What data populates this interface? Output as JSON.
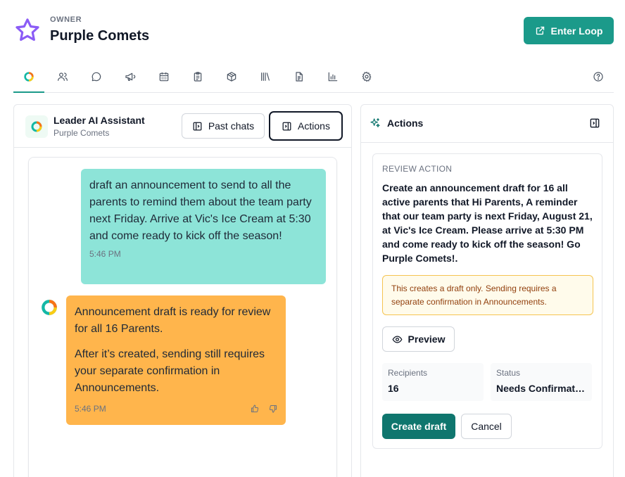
{
  "header": {
    "owner_label": "OWNER",
    "team_name": "Purple Comets",
    "enter_loop_label": "Enter Loop",
    "star_icon": "star-icon",
    "colors": {
      "accent": "#1b9a8a",
      "star": "#8b5cf6"
    }
  },
  "tabs": {
    "icons": [
      "loop-icon",
      "people-icon",
      "chat-icon",
      "megaphone-icon",
      "calendar-icon",
      "clipboard-icon",
      "box-icon",
      "library-icon",
      "document-icon",
      "chart-icon",
      "gear-icon",
      "help-icon"
    ],
    "active": "loop-icon"
  },
  "chat_panel": {
    "assistant_title": "Leader AI Assistant",
    "assistant_subtitle": "Purple Comets",
    "past_chats_label": "Past chats",
    "actions_label": "Actions",
    "messages": [
      {
        "role": "user",
        "text": "draft an announcement to send to all the parents to remind them about the team party next Friday. Arrive at Vic's Ice Cream at 5:30 and come ready to kick off the season!",
        "time": "5:46 PM",
        "color": "#8de4d8"
      },
      {
        "role": "assistant",
        "paragraphs": [
          "Announcement draft is ready for review for all 16 Parents.",
          "After it’s created, sending still requires your separate confirmation in Announcements."
        ],
        "time": "5:46 PM",
        "color": "#ffb54c"
      }
    ]
  },
  "actions_panel": {
    "title": "Actions",
    "review_label": "REVIEW ACTION",
    "description": "Create an announcement draft for 16 all active parents that Hi Parents, A reminder that our team party is next Friday, August 21, at Vic's Ice Cream. Please arrive at 5:30 PM and come ready to kick off the season! Go Purple Comets!.",
    "warning": "This creates a draft only. Sending requires a separate confirmation in Announcements.",
    "preview_label": "Preview",
    "recipients_label": "Recipients",
    "recipients_value": "16",
    "status_label": "Status",
    "status_value": "Needs Confirmation",
    "create_label": "Create draft",
    "cancel_label": "Cancel"
  }
}
